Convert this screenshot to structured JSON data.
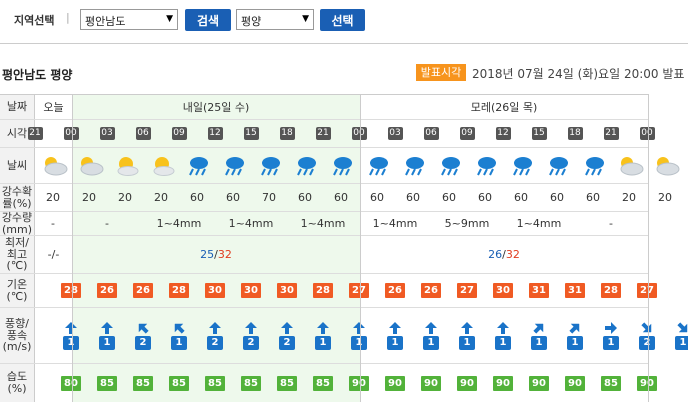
{
  "search": {
    "region_label": "지역선택",
    "separator": "|",
    "province": "평안남도",
    "search_button": "검색",
    "city": "평양",
    "select_button": "선택"
  },
  "location_title": "평안남도 평양",
  "announce": {
    "badge": "발표시각",
    "time": "2018년 07월 24일 (화)요일 20:00 발표"
  },
  "rows": {
    "date": "날짜",
    "hour": "시각",
    "weather": "날씨",
    "precip_prob": "강수확률(%)",
    "precip_amount": "강수량(mm)",
    "minmax": "최저/최고(℃)",
    "temp": "기온(℃)",
    "wind": "풍향/풍속(m/s)",
    "humidity": "습도(%)"
  },
  "days": {
    "today": "오늘",
    "tomorrow": "내일(25일 수)",
    "dayafter": "모레(26일 목)"
  },
  "hours": [
    "21",
    "00",
    "03",
    "06",
    "09",
    "12",
    "15",
    "18",
    "21",
    "00",
    "03",
    "06",
    "09",
    "12",
    "15",
    "18",
    "21",
    "00"
  ],
  "weather_icons": [
    "partly-cloudy-icon",
    "partly-cloudy-icon",
    "sun-cloud-icon",
    "sun-cloud-icon",
    "rain-icon",
    "rain-icon",
    "rain-icon",
    "rain-icon",
    "rain-icon",
    "rain-icon",
    "rain-icon",
    "rain-icon",
    "rain-icon",
    "rain-icon",
    "rain-icon",
    "rain-icon",
    "partly-cloudy-icon",
    "partly-cloudy-icon"
  ],
  "precip_prob": [
    "20",
    "20",
    "20",
    "20",
    "60",
    "60",
    "70",
    "60",
    "60",
    "60",
    "60",
    "60",
    "60",
    "60",
    "60",
    "60",
    "20",
    "20"
  ],
  "precip_amount": [
    {
      "text": "-",
      "col": 0,
      "span": 1
    },
    {
      "text": "-",
      "col": 1,
      "span": 2
    },
    {
      "text": "1~4mm",
      "col": 3,
      "span": 2
    },
    {
      "text": "1~4mm",
      "col": 5,
      "span": 2
    },
    {
      "text": "1~4mm",
      "col": 7,
      "span": 2
    },
    {
      "text": "1~4mm",
      "col": 9,
      "span": 2
    },
    {
      "text": "5~9mm",
      "col": 11,
      "span": 2
    },
    {
      "text": "1~4mm",
      "col": 13,
      "span": 2
    },
    {
      "text": "-",
      "col": 15,
      "span": 2
    }
  ],
  "minmax": {
    "today": "-/-",
    "tomorrow_min": "25",
    "tomorrow_max": "32",
    "dayafter_min": "26",
    "dayafter_max": "32",
    "slash": "/"
  },
  "temps": [
    "28",
    "26",
    "26",
    "28",
    "30",
    "30",
    "30",
    "28",
    "27",
    "26",
    "26",
    "27",
    "30",
    "31",
    "31",
    "28",
    "27"
  ],
  "wind_dirs": [
    "N",
    "N",
    "NW",
    "NW",
    "N",
    "N",
    "N",
    "N",
    "N",
    "N",
    "N",
    "N",
    "N",
    "NE",
    "NE",
    "E",
    "SE",
    "SE"
  ],
  "wind_speeds": [
    "1",
    "1",
    "2",
    "1",
    "2",
    "2",
    "2",
    "1",
    "1",
    "1",
    "1",
    "1",
    "1",
    "1",
    "1",
    "1",
    "2",
    "1"
  ],
  "humidity": [
    "80",
    "85",
    "85",
    "85",
    "85",
    "85",
    "85",
    "85",
    "90",
    "90",
    "90",
    "90",
    "90",
    "90",
    "90",
    "85",
    "90"
  ],
  "colors": {
    "button_blue": "#1a5fb4",
    "badge_orange": "#f7941d",
    "temp_orange": "#f05a23",
    "humidity_green": "#52b23a",
    "wind_blue": "#1a73c8",
    "tomorrow_bg": "#eef9ec"
  }
}
